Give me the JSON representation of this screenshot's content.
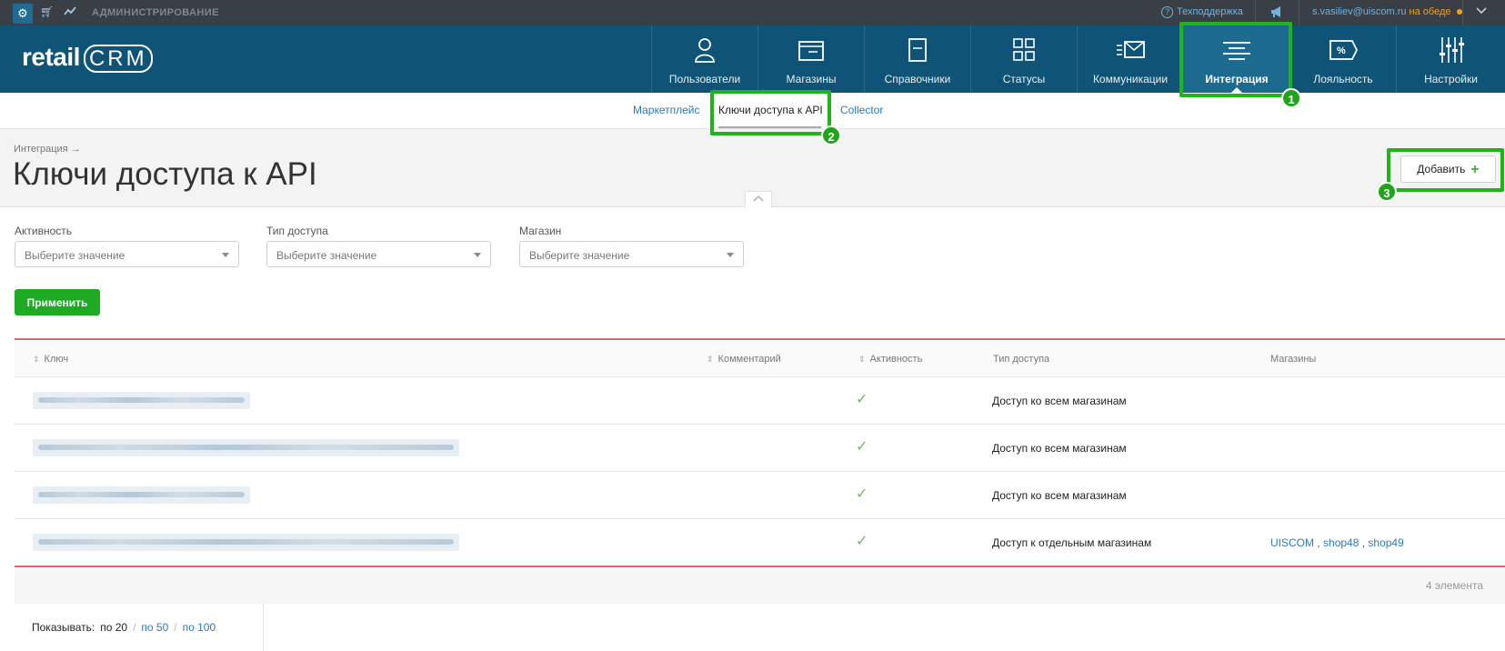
{
  "topbar": {
    "admin": "АДМИНИСТРИРОВАНИЕ",
    "support": "Техподдержка",
    "user_email": "s.vasiliev@uiscom.ru",
    "user_status": "на обеде"
  },
  "header": {
    "logo_text": "retail",
    "logo_crm": "CRM",
    "nav": [
      {
        "label": "Пользователи",
        "icon": "user-icon"
      },
      {
        "label": "Магазины",
        "icon": "store-icon"
      },
      {
        "label": "Справочники",
        "icon": "reference-icon"
      },
      {
        "label": "Статусы",
        "icon": "statuses-icon"
      },
      {
        "label": "Коммуникации",
        "icon": "communications-icon"
      },
      {
        "label": "Интеграция",
        "icon": "integration-icon"
      },
      {
        "label": "Лояльность",
        "icon": "loyalty-icon"
      },
      {
        "label": "Настройки",
        "icon": "settings-sliders-icon"
      }
    ],
    "active_nav": "Интеграция"
  },
  "subnav": {
    "items": [
      "Маркетплейс",
      "Ключи доступа к API",
      "Collector"
    ],
    "current": "Ключи доступа к API"
  },
  "annotations": {
    "badge1": "1",
    "badge2": "2",
    "badge3": "3",
    "highlight_color": "#1fb51a"
  },
  "page": {
    "breadcrumb": "Интеграция →",
    "title": "Ключи доступа к API",
    "add_button": "Добавить",
    "add_icon": "+"
  },
  "filters": {
    "activity_label": "Активность",
    "activity_placeholder": "Выберите значение",
    "access_type_label": "Тип доступа",
    "access_type_placeholder": "Выберите значение",
    "shop_label": "Магазин",
    "shop_placeholder": "Выберите значение",
    "apply_button": "Применить"
  },
  "table": {
    "columns": {
      "key": "Ключ",
      "comment": "Комментарий",
      "active": "Активность",
      "access_type": "Тип доступа",
      "shops": "Магазины"
    },
    "rows": [
      {
        "key_hidden": true,
        "active": "✓",
        "access_type": "Доступ ко всем магазинам",
        "shops": []
      },
      {
        "key_hidden": true,
        "active": "✓",
        "access_type": "Доступ ко всем магазинам",
        "shops": []
      },
      {
        "key_hidden": true,
        "active": "✓",
        "access_type": "Доступ ко всем магазинам",
        "shops": []
      },
      {
        "key_hidden": true,
        "active": "✓",
        "access_type": "Доступ к отдельным магазинам",
        "shops": [
          "UISCOM",
          "shop48",
          "shop49"
        ]
      }
    ],
    "count": "4  элемента"
  },
  "pager": {
    "label": "Показывать:",
    "options": [
      "по 20",
      "по 50",
      "по 100"
    ],
    "current": "по 20"
  },
  "colors": {
    "header_bg": "#0f5476",
    "topbar_bg": "#3a3f45",
    "apply_green": "#1faa24",
    "accent_line": "#e26273",
    "link": "#2b7bb9"
  }
}
